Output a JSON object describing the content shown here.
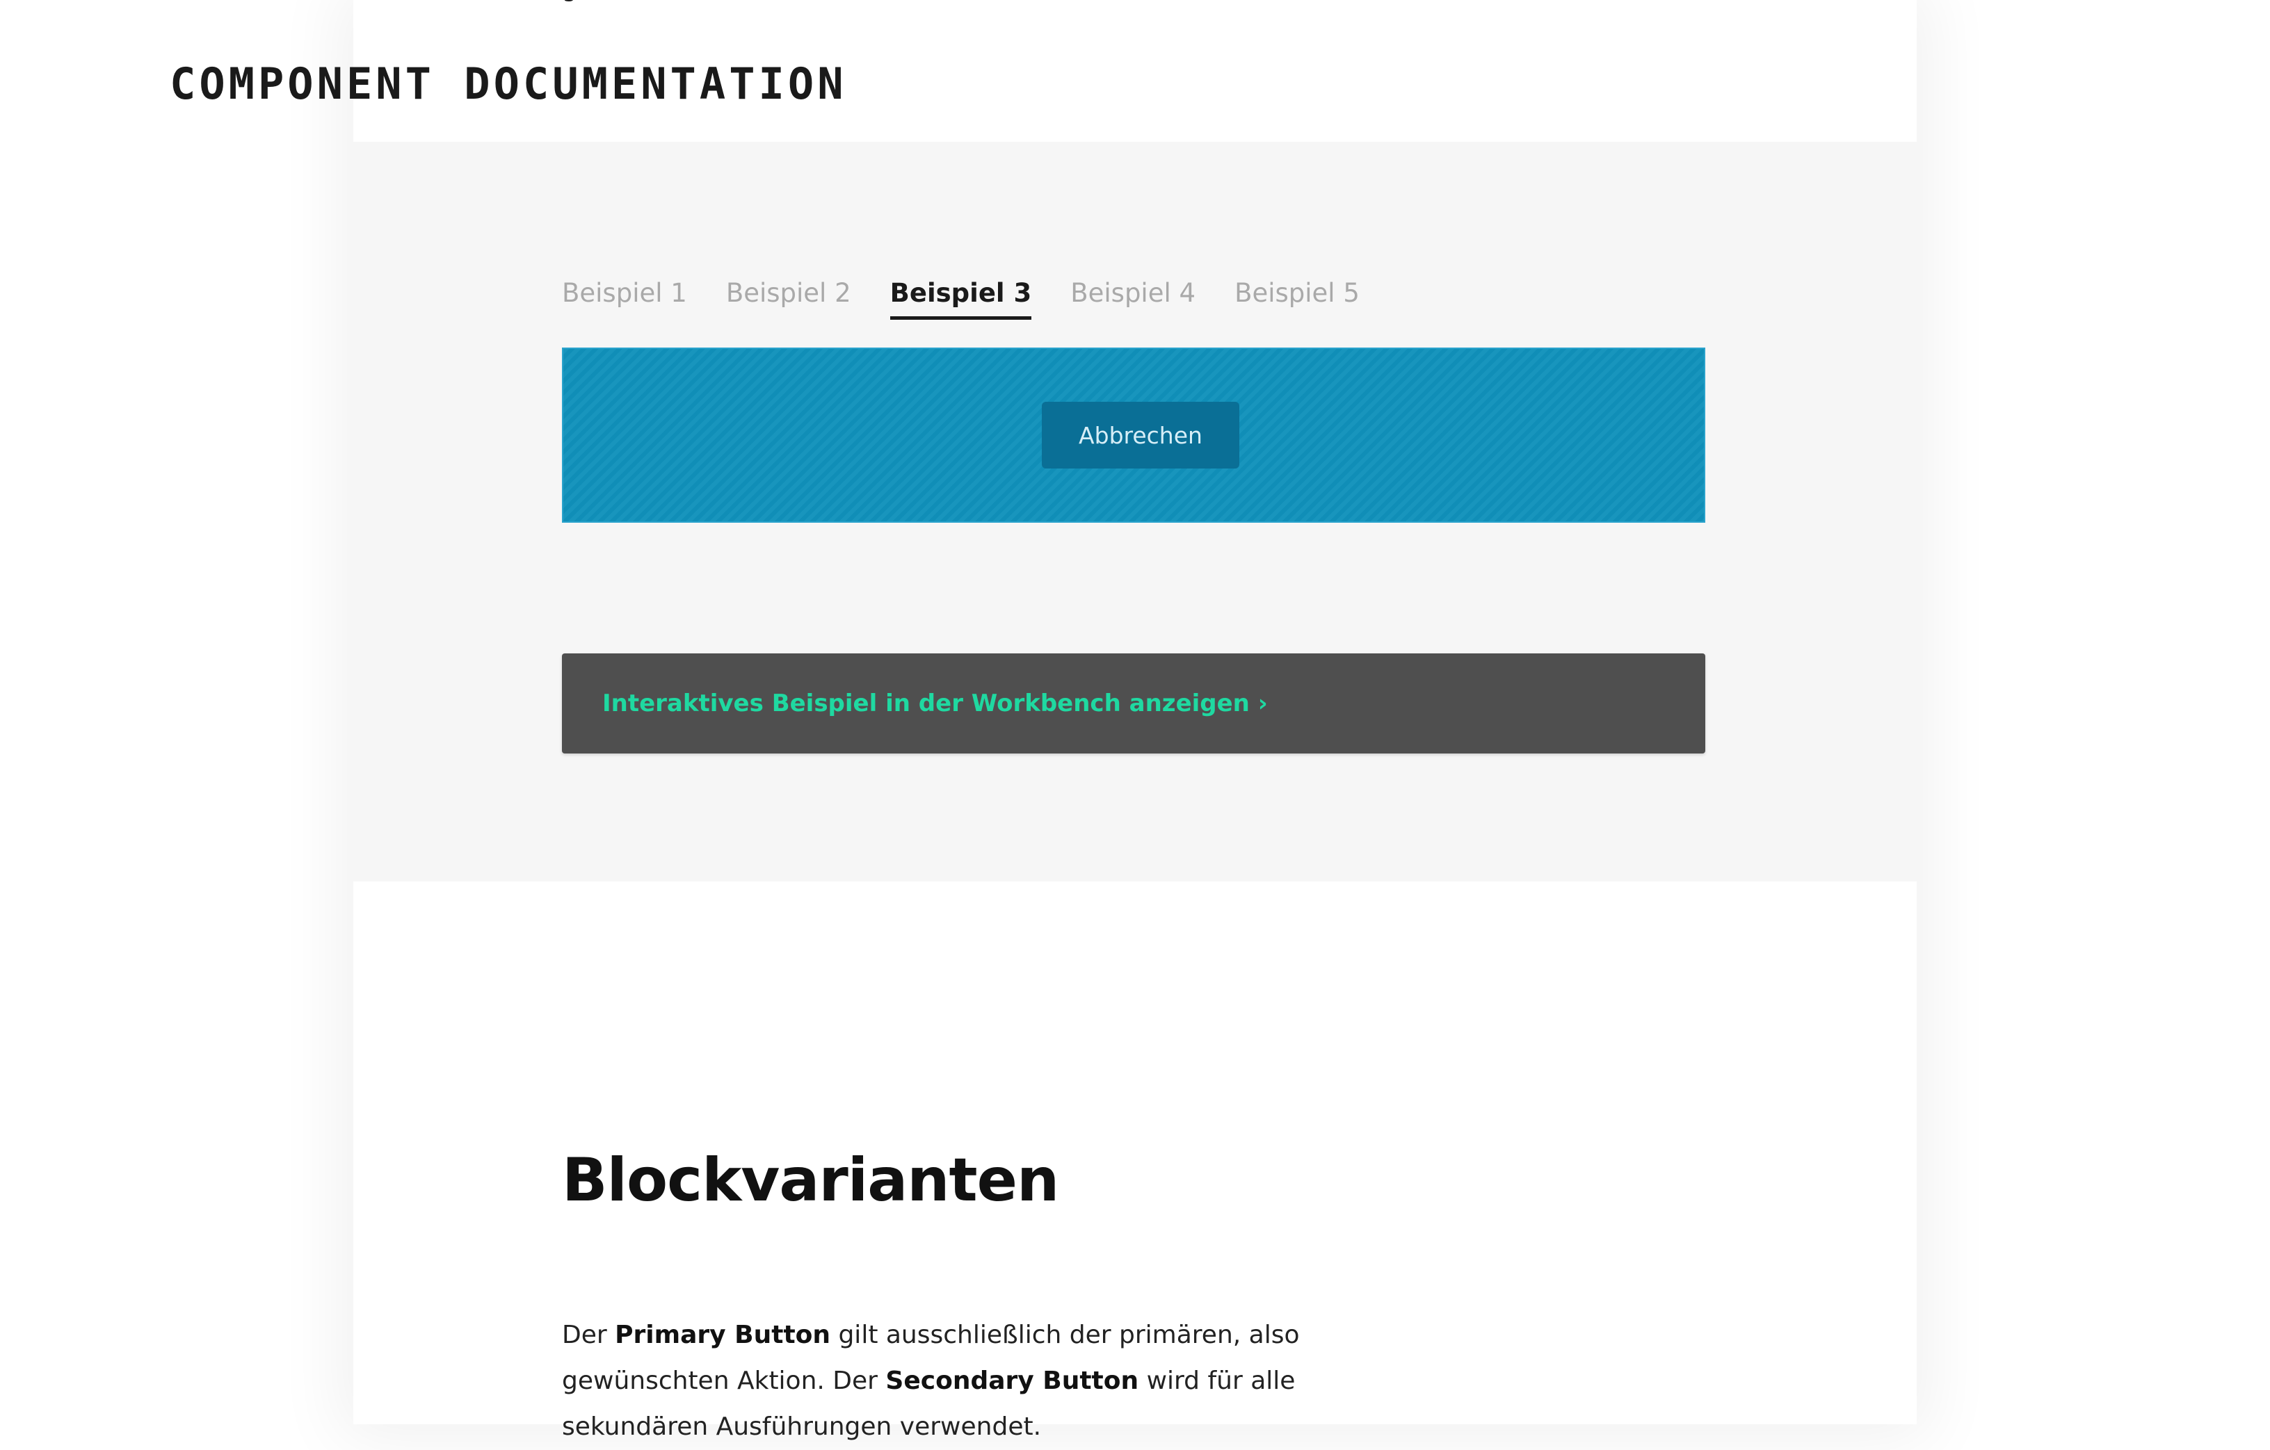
{
  "header": {
    "title": "COMPONENT DOCUMENTATION"
  },
  "top_fragment": "g",
  "tabs": [
    {
      "label": "Beispiel 1",
      "active": false
    },
    {
      "label": "Beispiel 2",
      "active": false
    },
    {
      "label": "Beispiel 3",
      "active": true
    },
    {
      "label": "Beispiel 4",
      "active": false
    },
    {
      "label": "Beispiel 5",
      "active": false
    }
  ],
  "preview": {
    "button_label": "Abbrechen",
    "background_color": "#1091bb"
  },
  "workbench": {
    "link_label": "Interaktives Beispiel in der Workbench anzeigen ›",
    "link_color": "#1fd9a1"
  },
  "section": {
    "heading": "Blockvarianten",
    "paragraph": {
      "p1": "Der ",
      "b1": "Primary Button",
      "p2": " gilt ausschließlich der primären, also gewünschten Aktion. Der ",
      "b2": "Secondary Button",
      "p3": " wird für alle sekundären Ausführungen verwendet."
    }
  }
}
